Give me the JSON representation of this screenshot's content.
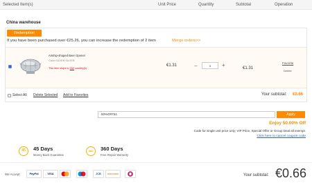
{
  "header": {
    "selected_items": "Selected Item(s)",
    "unit_price": "Unit Price",
    "quantity": "Quantity",
    "subtotal": "Subtotal",
    "operation": "Operation"
  },
  "warehouse": {
    "title": "China warehouse",
    "redemption_label": "Redemption",
    "redemption_message": "If you have been purchased over €25.26, you can increase the redemption of 2 item",
    "merge_link": "Merge orders>>"
  },
  "item": {
    "name": "Airship-shaped Beer Opener",
    "color": "Color:SILVER,SILVER",
    "ship_note_prefix": "This item ships to ",
    "ship_note_count": "252",
    "ship_note_suffix": " country(s)",
    "unit_price": "€1.31",
    "quantity": "1",
    "subtotal": "€1.31",
    "favorite": "Favorite",
    "delete": "Delete",
    "checked": true
  },
  "bulk_actions": {
    "select_all": "Select All",
    "delete_selected": "Delete Selected",
    "add_to_favorites": "Add to Favorites"
  },
  "warehouse_subtotal": {
    "label": "Your subtotal:",
    "value": "€0.66"
  },
  "coupon": {
    "code": "50%OFF51",
    "apply_label": "Apply",
    "enjoy_text": "Enjoy 50.00% Off",
    "note": "Code for single unit price only; VIP Price, Special Offer or Group Deal all exempt.",
    "cancel_link": "Click here to cancel coupon code"
  },
  "guarantees": [
    {
      "badge": "45",
      "title": "45 Days",
      "subtitle": "Money Back Guarantee"
    },
    {
      "badge": "360",
      "title": "360 Days",
      "subtitle": "Free Repair Warranty"
    }
  ],
  "footer": {
    "we_accept": "We Accept:",
    "payment_methods": [
      "PayPal",
      "VISA",
      "MC",
      "Maestro",
      "JCB",
      "DISCOVER",
      "Boleto"
    ],
    "subtotal_label": "Your subtotal:",
    "subtotal_value": "€0.66"
  },
  "colors": {
    "accent": "#ff8a00",
    "link_blue": "#2b5fcf",
    "alert_red": "#d0021b",
    "badge_gold": "#f1b300"
  }
}
